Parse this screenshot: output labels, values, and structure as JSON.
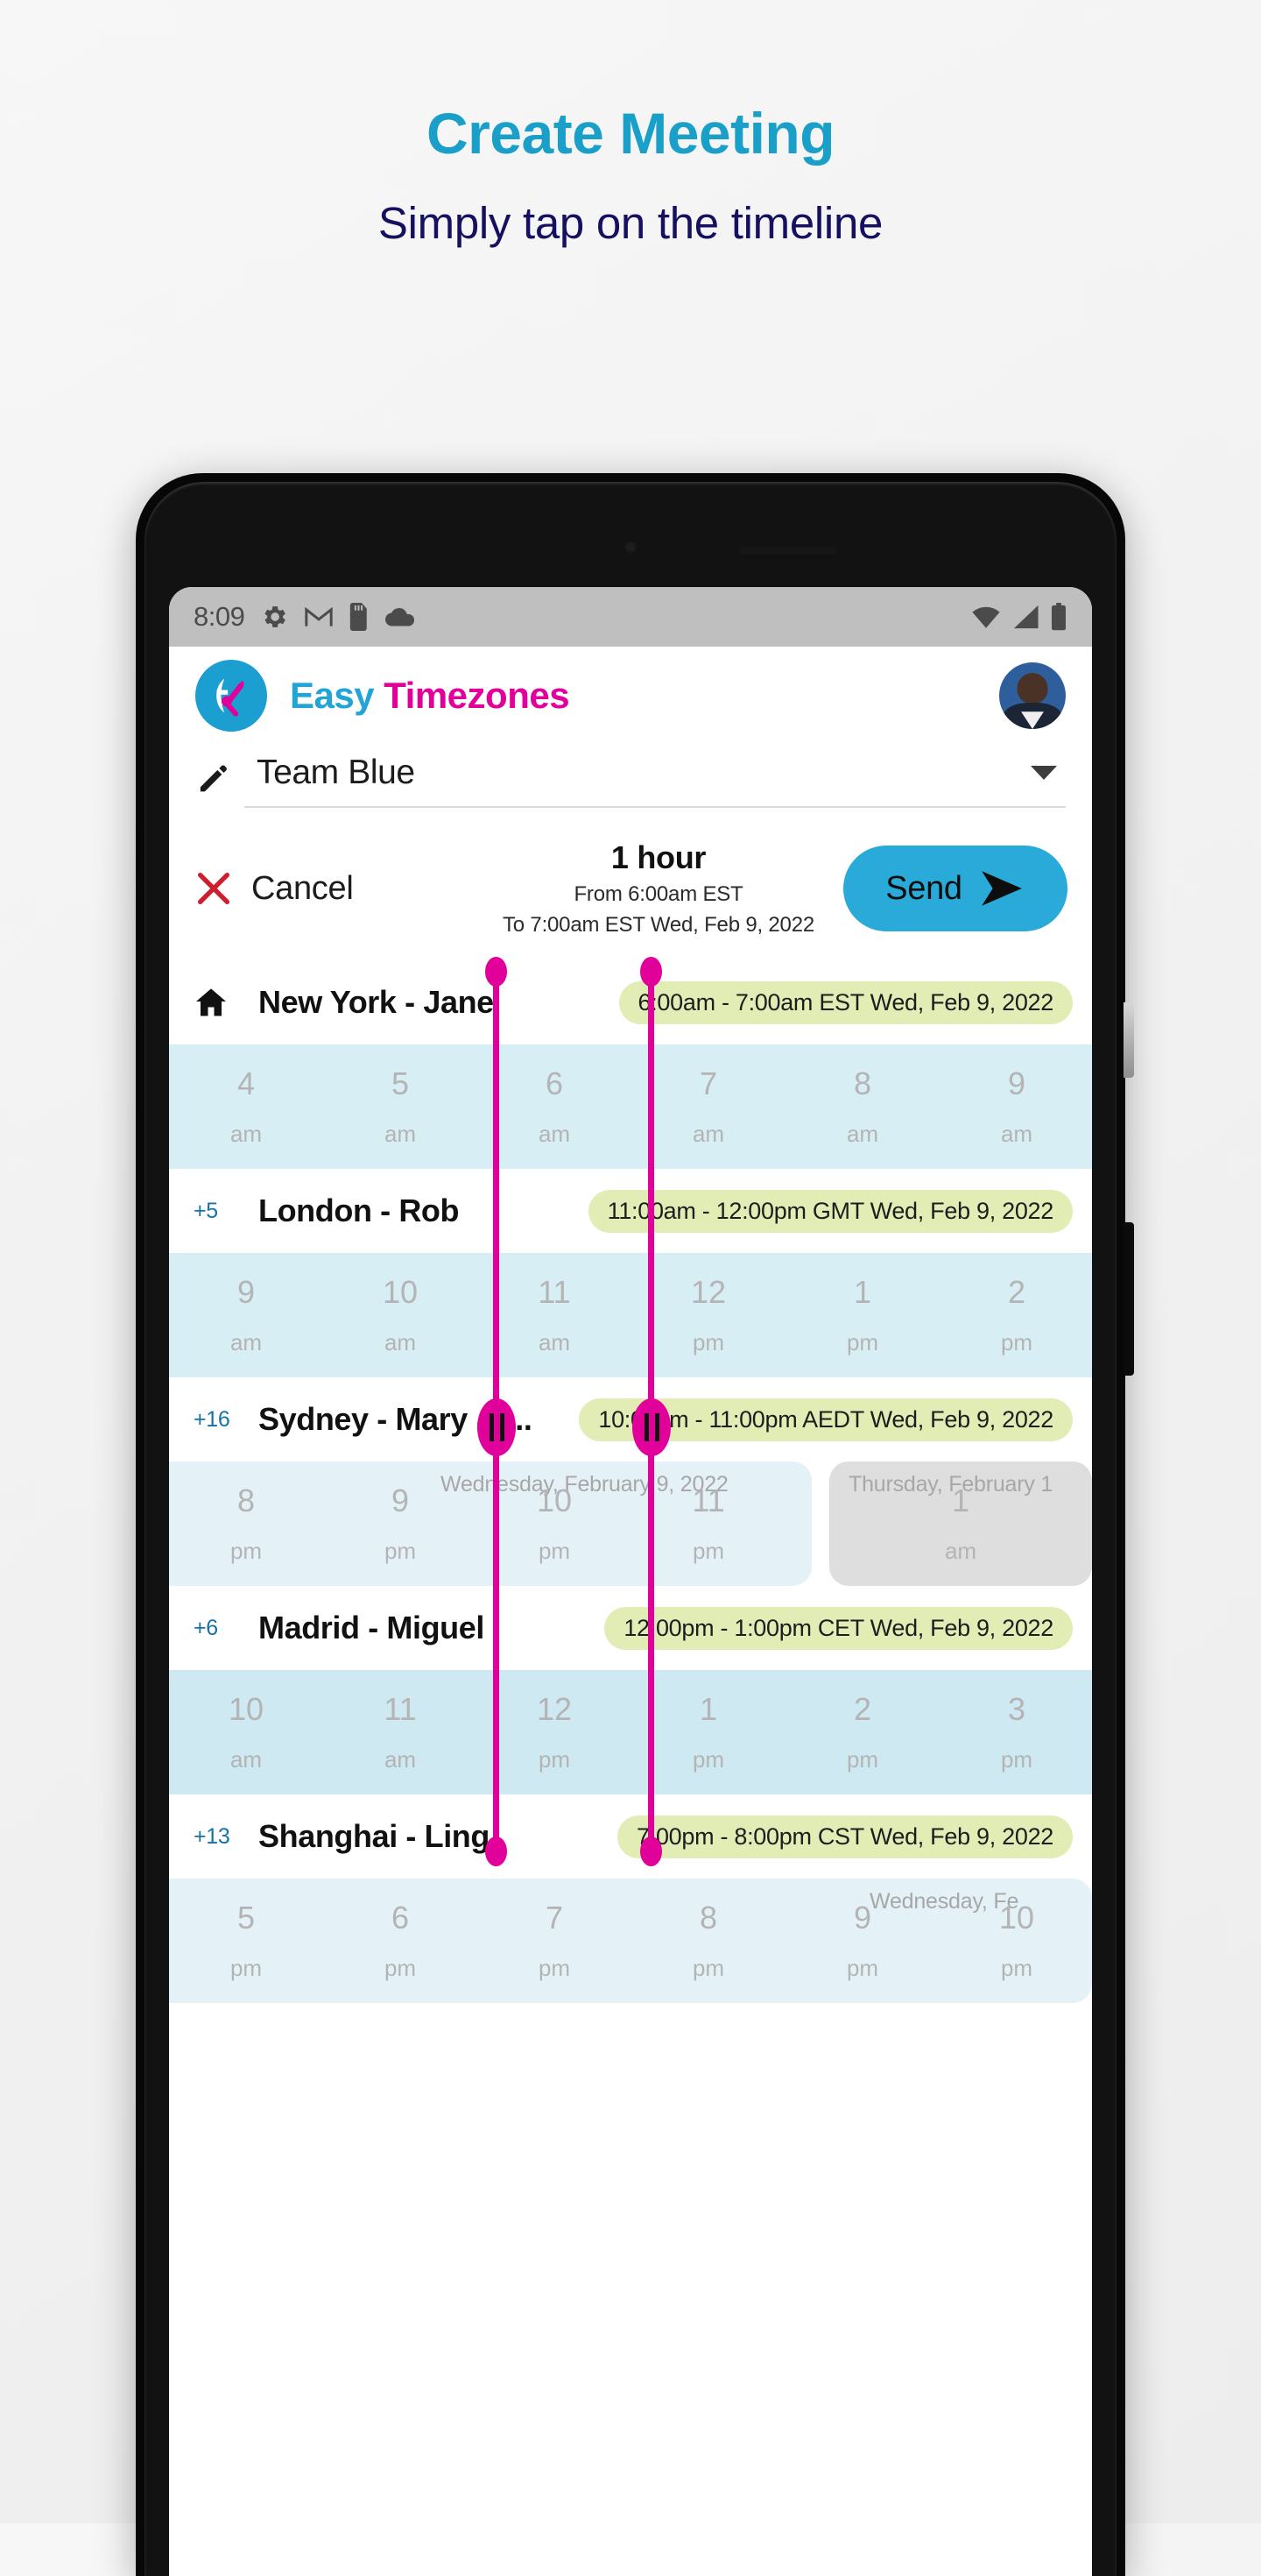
{
  "promo": {
    "title": "Create Meeting",
    "subtitle": "Simply tap on the timeline",
    "title_color": "#1a9fc9",
    "subtitle_color": "#151060"
  },
  "statusbar": {
    "time": "8:09",
    "left_icons": [
      "gear-icon",
      "gmail-icon",
      "sd-card-icon",
      "cloud-icon"
    ],
    "right_icons": [
      "wifi-icon",
      "signal-icon",
      "battery-icon"
    ]
  },
  "appbar": {
    "logo": "globe-pin-logo",
    "brand_first": "Easy",
    "brand_second": "Timezones",
    "brand_first_color": "#22a5d6",
    "brand_second_color": "#e2009b",
    "avatar": "user-avatar"
  },
  "team_selector": {
    "icon": "pencil-icon",
    "value": "Team Blue",
    "caret": "chevron-down-icon"
  },
  "action_bar": {
    "cancel_icon": "close-x-icon",
    "cancel_label": "Cancel",
    "duration": "1 hour",
    "from_line": "From 6:00am EST",
    "to_line": "To 7:00am EST Wed, Feb 9, 2022",
    "send_label": "Send",
    "send_icon": "send-arrow-icon",
    "send_color": "#2aaad8"
  },
  "timeline": {
    "marker_color": "#e2009b",
    "pill_color": "#e1edb5",
    "cities": [
      {
        "badge": "",
        "badge_icon": "home-icon",
        "name": "New York - Jane",
        "pill": "6:00am - 7:00am EST Wed, Feb 9, 2022",
        "hours": [
          {
            "num": "4",
            "ampm": "am"
          },
          {
            "num": "5",
            "ampm": "am"
          },
          {
            "num": "6",
            "ampm": "am"
          },
          {
            "num": "7",
            "ampm": "am"
          },
          {
            "num": "8",
            "ampm": "am"
          },
          {
            "num": "9",
            "ampm": "am"
          }
        ],
        "day_labels": []
      },
      {
        "badge": "+5",
        "badge_icon": "",
        "name": "London - Rob",
        "pill": "11:00am - 12:00pm GMT Wed, Feb 9, 2022",
        "hours": [
          {
            "num": "9",
            "ampm": "am"
          },
          {
            "num": "10",
            "ampm": "am"
          },
          {
            "num": "11",
            "ampm": "am"
          },
          {
            "num": "12",
            "ampm": "pm"
          },
          {
            "num": "1",
            "ampm": "pm"
          },
          {
            "num": "2",
            "ampm": "pm"
          }
        ],
        "day_labels": []
      },
      {
        "badge": "+16",
        "badge_icon": "",
        "name": "Sydney - Mary & ...",
        "pill": "10:00pm - 11:00pm AEDT Wed, Feb 9, 2022",
        "hours": [
          {
            "num": "8",
            "ampm": "pm"
          },
          {
            "num": "9",
            "ampm": "pm"
          },
          {
            "num": "10",
            "ampm": "pm"
          },
          {
            "num": "11",
            "ampm": "pm"
          }
        ],
        "next_day_hours": [
          {
            "num": "1",
            "ampm": "am"
          }
        ],
        "day_labels": [
          "Wednesday, February 9, 2022",
          "Thursday, February 1"
        ]
      },
      {
        "badge": "+6",
        "badge_icon": "",
        "name": "Madrid - Miguel",
        "pill": "12:00pm - 1:00pm CET Wed, Feb 9, 2022",
        "hours": [
          {
            "num": "10",
            "ampm": "am"
          },
          {
            "num": "11",
            "ampm": "am"
          },
          {
            "num": "12",
            "ampm": "pm"
          },
          {
            "num": "1",
            "ampm": "pm"
          },
          {
            "num": "2",
            "ampm": "pm"
          },
          {
            "num": "3",
            "ampm": "pm"
          }
        ],
        "day_labels": []
      },
      {
        "badge": "+13",
        "badge_icon": "",
        "name": "Shanghai - Ling",
        "pill": "7:00pm - 8:00pm CST Wed, Feb 9, 2022",
        "hours": [
          {
            "num": "5",
            "ampm": "pm"
          },
          {
            "num": "6",
            "ampm": "pm"
          },
          {
            "num": "7",
            "ampm": "pm"
          },
          {
            "num": "8",
            "ampm": "pm"
          },
          {
            "num": "9",
            "ampm": "pm"
          },
          {
            "num": "10",
            "ampm": "pm"
          }
        ],
        "day_labels": [
          "Wednesday, Fe"
        ]
      }
    ]
  }
}
